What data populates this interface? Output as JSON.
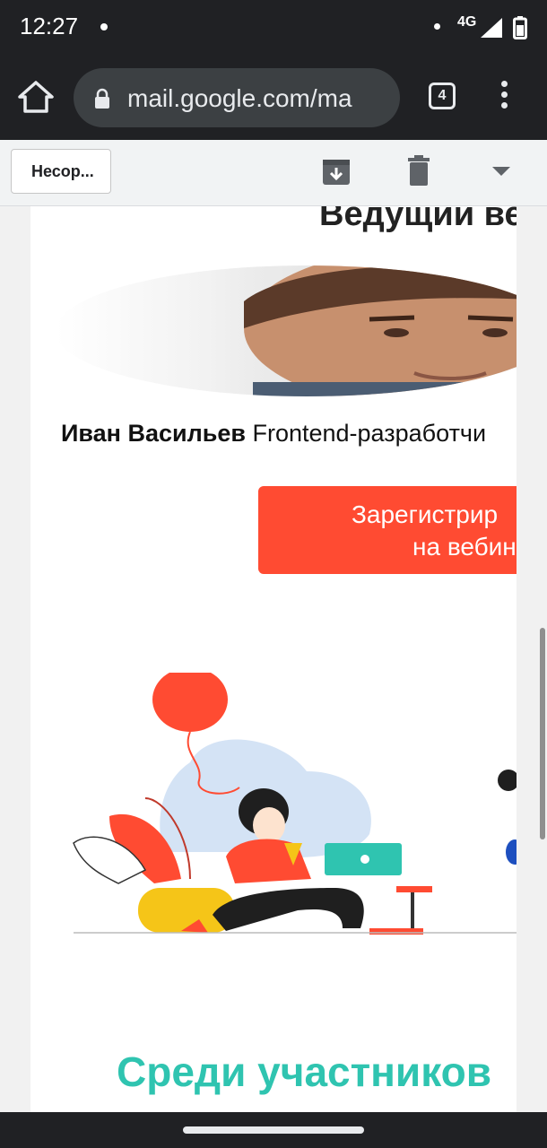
{
  "status_bar": {
    "time": "12:27",
    "network": "4G"
  },
  "browser": {
    "url": "mail.google.com/ma",
    "tab_count": "4"
  },
  "gmail_toolbar": {
    "back_label": "Несор..."
  },
  "email": {
    "heading": "Ведущий ве",
    "speaker_name": "Иван Васильев",
    "speaker_role": "Frontend-разработчи",
    "register_line1": "Зарегистрир",
    "register_line2": "на вебин",
    "section_title": "Среди участников"
  },
  "colors": {
    "accent_button": "#ff4b32",
    "section_title": "#2fc4b0",
    "browser_bar": "#202124"
  },
  "icons": [
    "home-icon",
    "lock-icon",
    "tabs-icon",
    "overflow-menu-icon",
    "archive-icon",
    "trash-icon",
    "dropdown-icon"
  ]
}
